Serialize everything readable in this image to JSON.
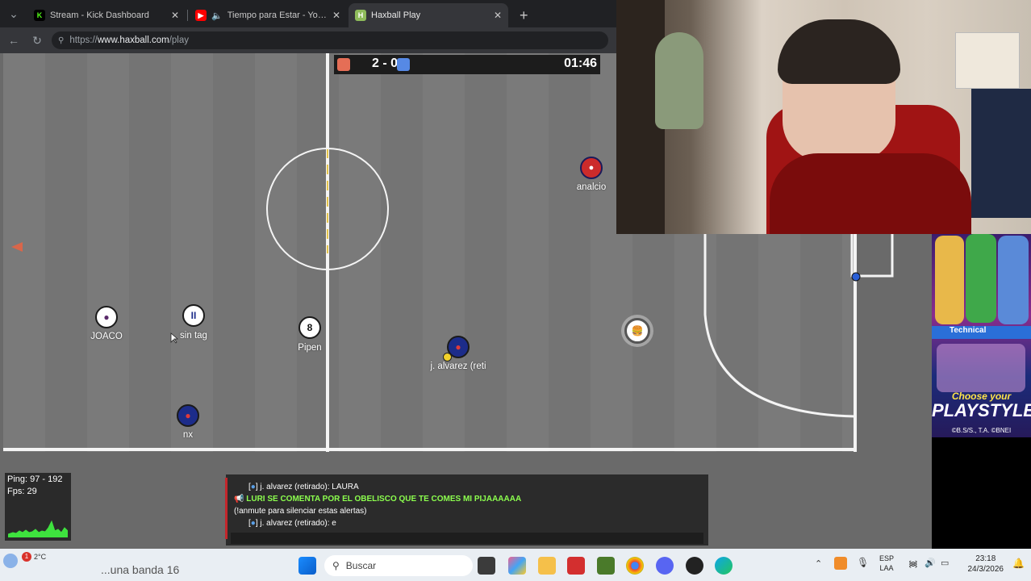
{
  "browser": {
    "tabs": [
      {
        "label": "Stream - Kick Dashboard",
        "icon": "kick-icon",
        "color": "#53fc18"
      },
      {
        "label": "Tiempo para Estar - YouTube",
        "icon": "youtube-icon",
        "color": "#ff0000"
      },
      {
        "label": "Haxball Play",
        "icon": "haxball-icon",
        "color": "#8fbc5b"
      }
    ],
    "new_tab": "+",
    "url_scheme": "https://",
    "url_host": "www.haxball.com",
    "url_path": "/play"
  },
  "game": {
    "score": "2 - 0",
    "clock": "01:46",
    "team_colors": {
      "red": "#e56e56",
      "blue": "#5689e5"
    },
    "players": [
      {
        "name": "analcio",
        "badge": "",
        "color": "#cc2b2b"
      },
      {
        "name": "JOACO",
        "badge": "",
        "color": "#ffffff"
      },
      {
        "name": "sin tag",
        "badge": "II",
        "color": "#ffffff"
      },
      {
        "name": "Pipen",
        "badge": "8",
        "color": "#ffffff"
      },
      {
        "name": "j. alvarez (reti",
        "badge": "",
        "color": "#1c2c8a"
      },
      {
        "name": "nx",
        "badge": "",
        "color": "#1c2c8a"
      }
    ]
  },
  "stats": {
    "ping": "Ping: 97 - 192",
    "fps": "Fps: 29"
  },
  "chat": {
    "messages": [
      {
        "prefix": "[",
        "suffix": "] j. alvarez (retirado): LAURA"
      },
      {
        "text": "LURI SE COMENTA POR EL OBELISCO QUE TE COMES MI PIJAAAAAA"
      },
      {
        "text": "(!anmute para silenciar estas alertas)"
      },
      {
        "prefix": "[",
        "suffix": "] j. alvarez (retirado): e"
      }
    ]
  },
  "ad": {
    "top_label": "Technical",
    "cta_line1": "Choose your",
    "cta_line2": "PLAYSTYLE",
    "copyright": "©B.S/S., T.A. ©BNEI"
  },
  "taskbar": {
    "search_placeholder": "Buscar",
    "weather_badge": "1",
    "weather_temp": "2°C",
    "overlay_text": "...una banda 16",
    "lang_line1": "ESP",
    "lang_line2": "LAA",
    "time": "23:18",
    "date": "24/3/2026"
  }
}
